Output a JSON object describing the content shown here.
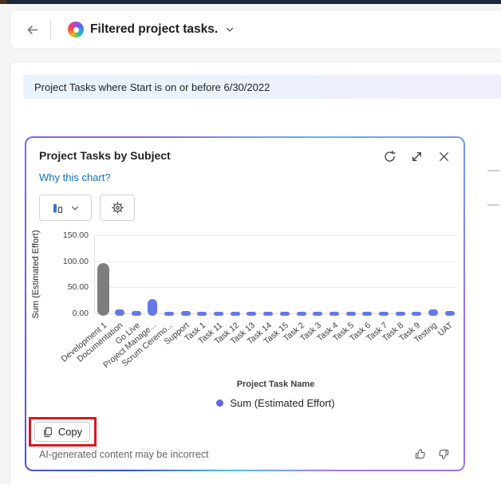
{
  "app": {
    "topbar": {
      "title": "Filtered project tasks."
    },
    "filter_banner": "Project Tasks where Start is on or before 6/30/2022"
  },
  "card": {
    "title": "Project Tasks by Subject",
    "why_link": "Why this chart?",
    "copy_button": "Copy",
    "disclaimer": "AI-generated content may be incorrect"
  },
  "chart_data": {
    "type": "bar",
    "title": "Project Tasks by Subject",
    "xlabel": "Project Task Name",
    "ylabel": "Sum (Estimated Effort)",
    "legend": [
      "Sum (Estimated Effort)"
    ],
    "legend_position": "bottom",
    "grid": true,
    "ylim": [
      0,
      150
    ],
    "yticks": [
      {
        "value": 0,
        "label": "0.00"
      },
      {
        "value": 50,
        "label": "50.00"
      },
      {
        "value": 100,
        "label": "100.00"
      },
      {
        "value": 150,
        "label": "150.00"
      }
    ],
    "categories": [
      "Development 1",
      "Documentation",
      "Go Live",
      "Project Manage...",
      "Scrum Ceremo...",
      "Support",
      "Task 1",
      "Task 11",
      "Task 12",
      "Task 13",
      "Task 14",
      "Task 15",
      "Task 2",
      "Task 3",
      "Task 4",
      "Task 5",
      "Task 6",
      "Task 7",
      "Task 8",
      "Task 9",
      "Testing",
      "UAT"
    ],
    "series": [
      {
        "name": "Sum (Estimated Effort)",
        "values": [
          97,
          8,
          4,
          28,
          3,
          4,
          2,
          2,
          1,
          1,
          1,
          1,
          2,
          1,
          2,
          1,
          2,
          1,
          2,
          1,
          8,
          4
        ]
      }
    ],
    "bar_colors": {
      "default": "#6678e6",
      "Development 1": "#7d7d7d"
    }
  },
  "colors": {
    "link": "#0f6cbd",
    "highlight_red": "#d71920",
    "legend_dot": "#5b68e0"
  }
}
